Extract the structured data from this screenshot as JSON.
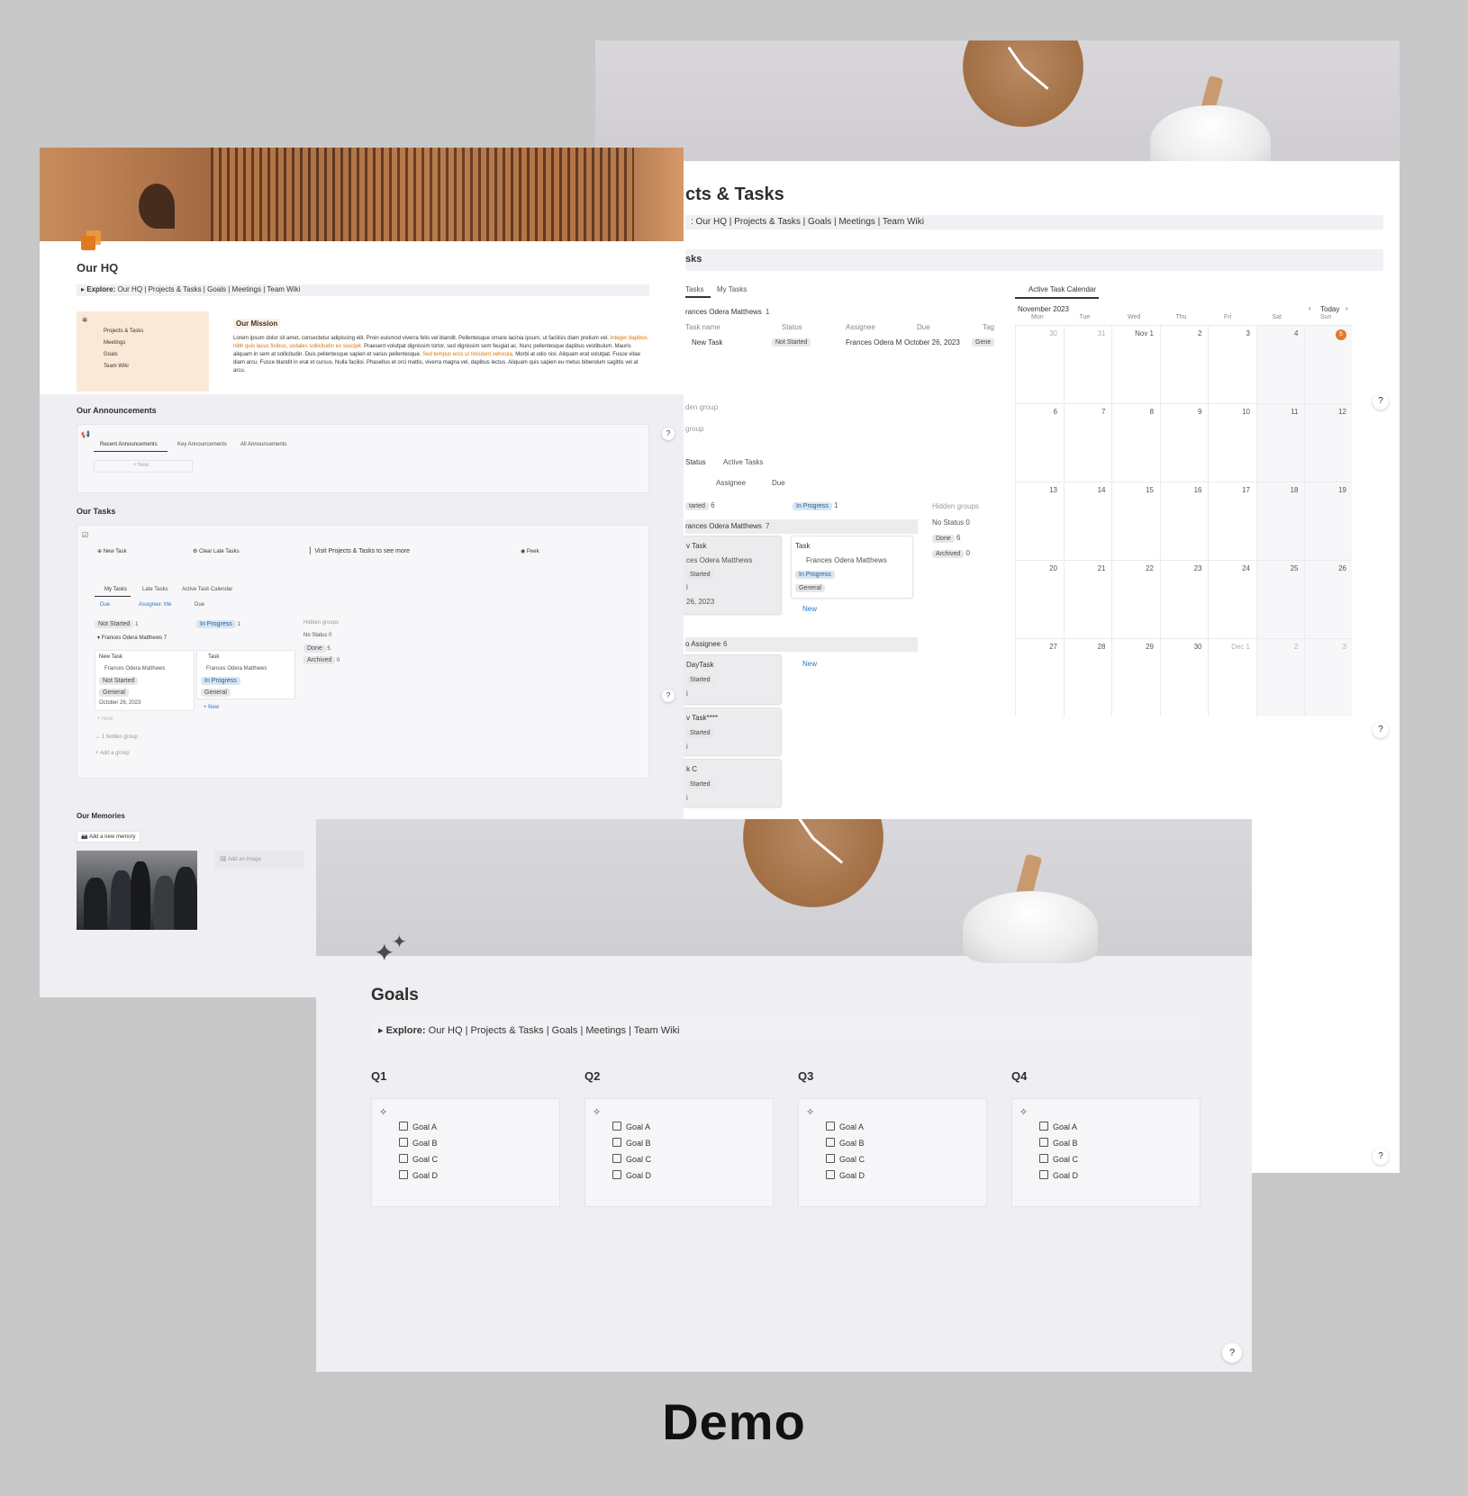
{
  "demo_label": "Demo",
  "explore_bar": {
    "prefix": "▸ Explore:",
    "items": [
      "Our HQ",
      "Projects & Tasks",
      "Goals",
      "Meetings",
      "Team Wiki"
    ]
  },
  "projects_window": {
    "title": "cts & Tasks",
    "explore_text": ": Our HQ | Projects & Tasks | Goals | Meetings | Team Wiki",
    "section_title": "sks",
    "tabs": [
      "Tasks",
      "My Tasks"
    ],
    "calendar_tab": "Active Task Calendar",
    "group_owner": "rances Odera Matthews",
    "group_count": "1",
    "columns": [
      "Task name",
      "Status",
      "Assignee",
      "Due",
      "Tag"
    ],
    "row": {
      "name": "New Task",
      "status": "Not Started",
      "assignee": "Frances Odera M",
      "due": "October 26, 2023",
      "tag": "Gene"
    },
    "hidden_group": "den group",
    "add_group": "group",
    "board_tabs": [
      "Status",
      "Active Tasks"
    ],
    "board_filters": [
      "Assignee",
      "Due"
    ],
    "board_columns": [
      {
        "label": "tarted",
        "count": "6"
      },
      {
        "label": "In Progress",
        "count": "1"
      }
    ],
    "hidden_groups_label": "Hidden groups",
    "hidden_groups": [
      {
        "label": "No Status",
        "count": "0"
      },
      {
        "label": "Done",
        "count": "6"
      },
      {
        "label": "Archived",
        "count": "0"
      }
    ],
    "board_group_owner": "rances Odera Matthews",
    "board_group_count": "7",
    "board_card_left": {
      "title": "v Task",
      "assignee": "ces Odera Matthews",
      "status": "Started",
      "extra": "i",
      "due": "26, 2023"
    },
    "board_card_right": {
      "title": "Task",
      "assignee": "Frances Odera Matthews",
      "status": "In Progress",
      "tag": "General"
    },
    "new_label": "New",
    "no_assignee": "o Assignee",
    "no_assignee_count": "6",
    "no_assignee_cards": [
      {
        "title": "DayTask",
        "status": "Started",
        "extra": "i"
      },
      {
        "title": "v Task****",
        "status": "Started",
        "extra": "i"
      },
      {
        "title": "k C",
        "status": "Started",
        "extra": "i"
      }
    ],
    "calendar": {
      "month": "November 2023",
      "today_label": "Today",
      "weekdays": [
        "Mon",
        "Tue",
        "Wed",
        "Thu",
        "Fri",
        "Sat",
        "Sun"
      ],
      "weeks": [
        [
          "30",
          "31",
          "Nov 1",
          "2",
          "3",
          "4",
          "5"
        ],
        [
          "6",
          "7",
          "8",
          "9",
          "10",
          "11",
          "12"
        ],
        [
          "13",
          "14",
          "15",
          "16",
          "17",
          "18",
          "19"
        ],
        [
          "20",
          "21",
          "22",
          "23",
          "24",
          "25",
          "26"
        ],
        [
          "27",
          "28",
          "29",
          "30",
          "Dec 1",
          "2",
          "3"
        ]
      ],
      "today": "5"
    }
  },
  "hq_window": {
    "title": "Our HQ",
    "nav": [
      "Projects & Tasks",
      "Meetings",
      "Goals",
      "Team Wiki"
    ],
    "mission_title": "Our Mission",
    "mission_p1": "Lorem ipsum dolor sit amet, consectetur adipiscing elit. Proin euismod viverra felis vel blandit. Pellentesque ornare lacinia ipsum, ut facilisis diam pretium vel.",
    "mission_p2_orange": "Integer dapibus nibh quis lacus finibus, sodales sollicitudin ex suscipit.",
    "mission_p3": " Praesent volutpat dignissim tortor, sed dignissim sem feugiat ac. Nunc pellentesque dapibus vestibulum. Mauris aliquam in sem at sollicitudin. Duis pellentesque sapien et varius pellentesque.",
    "mission_p4_orange": " Sed tempus eros ut tincidunt vehicula.",
    "mission_p5": " Morbi at odio nisl. Aliquam erat volutpat. Fusce vitae diam arcu. Fusce blandit in erat et cursus. Nulla facilisi. Phasellus et orci mattis, viverra magna vel, dapibus lectus. Aliquam quis sapien eu metus bibendum sagittis vel at arcu.",
    "announcements_title": "Our Announcements",
    "announcement_tabs": [
      "Recent Announcements",
      "Key Announcements",
      "All Announcements"
    ],
    "new_label": "+ New",
    "tasks_title": "Our Tasks",
    "task_buttons": [
      "New Task",
      "Clear Late Tasks"
    ],
    "visit_text": "Visit",
    "visit_link": "Projects & Tasks",
    "visit_suffix": "to see more",
    "peek": "Peek",
    "task_tabs": [
      "My Tasks",
      "Late Tasks",
      "Active Task Calendar"
    ],
    "task_filters": [
      "Due",
      "Assignee: Me",
      "Due"
    ],
    "board_cols": [
      {
        "label": "Not Started",
        "count": "1"
      },
      {
        "label": "In Progress",
        "count": "1"
      }
    ],
    "hidden_groups_label": "Hidden groups",
    "hidden_groups": [
      {
        "label": "No Status",
        "count": "0"
      },
      {
        "label": "Done",
        "count": "5"
      },
      {
        "label": "Archived",
        "count": "0"
      }
    ],
    "group_owner": "Frances Odera Matthews",
    "group_count": "7",
    "card_left": {
      "title": "New Task",
      "assignee": "Frances Odera Matthews",
      "status": "Not Started",
      "tag": "General",
      "due": "October 26, 2023"
    },
    "card_right": {
      "title": "Task",
      "assignee": "Frances Odera Matthews",
      "status": "In Progress",
      "tag": "General"
    },
    "plus_new": "+ New",
    "hidden_group_line": "1 hidden group",
    "add_group": "+ Add a group",
    "memories_title": "Our Memories",
    "add_memory": "Add a new memory",
    "add_image": "Add an image"
  },
  "goals_window": {
    "title": "Goals",
    "quarters": [
      {
        "label": "Q1",
        "goals": [
          "Goal A",
          "Goal B",
          "Goal C",
          "Goal D"
        ]
      },
      {
        "label": "Q2",
        "goals": [
          "Goal A",
          "Goal B",
          "Goal C",
          "Goal D"
        ]
      },
      {
        "label": "Q3",
        "goals": [
          "Goal A",
          "Goal B",
          "Goal C",
          "Goal D"
        ]
      },
      {
        "label": "Q4",
        "goals": [
          "Goal A",
          "Goal B",
          "Goal C",
          "Goal D"
        ]
      }
    ]
  },
  "help_label": "?",
  "colors": {
    "accent_orange": "#e07a1f",
    "background": "#c8c8c8",
    "page": "#efeef2"
  }
}
